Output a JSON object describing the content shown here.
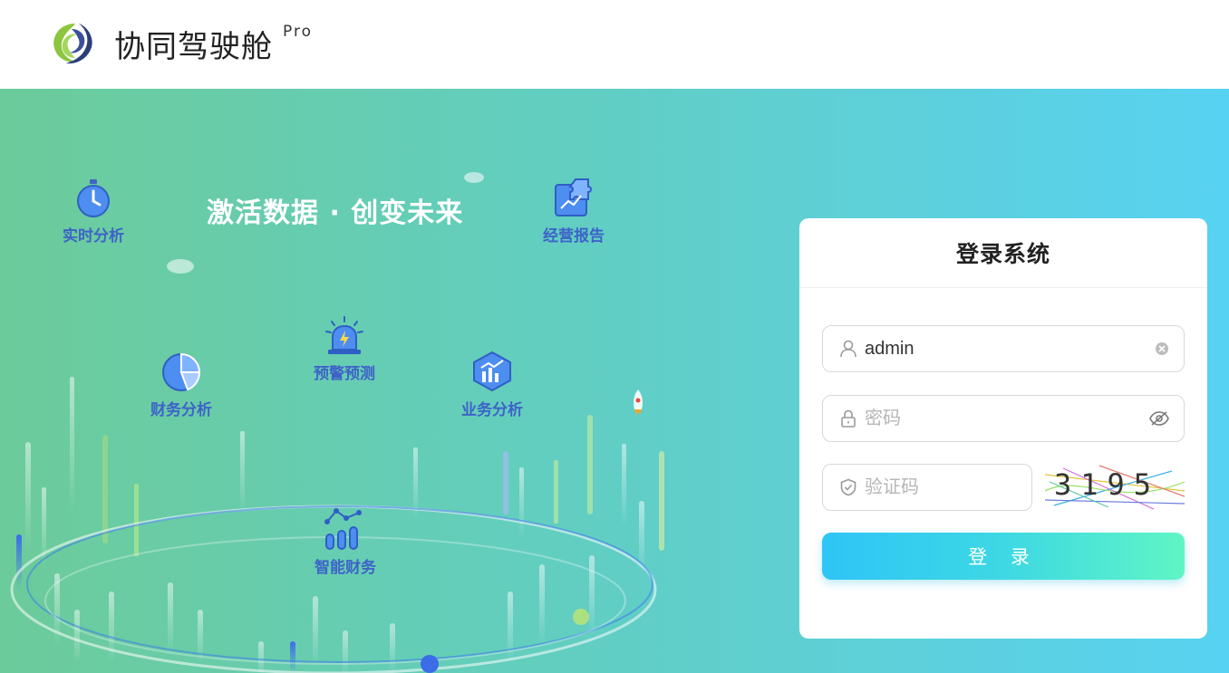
{
  "header": {
    "brand": "协同驾驶舱",
    "badge": "Pro"
  },
  "hero": {
    "slogan": "激活数据 · 创变未来",
    "features": [
      {
        "label": "实时分析",
        "icon": "stopwatch-icon"
      },
      {
        "label": "经营报告",
        "icon": "puzzle-report-icon"
      },
      {
        "label": "预警预测",
        "icon": "alarm-siren-icon"
      },
      {
        "label": "财务分析",
        "icon": "pie-chart-icon"
      },
      {
        "label": "业务分析",
        "icon": "cube-chart-icon"
      },
      {
        "label": "智能财务",
        "icon": "smart-bars-icon"
      }
    ]
  },
  "login": {
    "title": "登录系统",
    "username": {
      "value": "admin",
      "placeholder": "",
      "icon": "user-icon",
      "action_icon": "clear-icon"
    },
    "password": {
      "value": "",
      "placeholder": "密码",
      "icon": "lock-icon",
      "action_icon": "eye-off-icon"
    },
    "captcha": {
      "value": "",
      "placeholder": "验证码",
      "icon": "shield-icon",
      "image_text": "3195"
    },
    "submit_label": "登 录"
  },
  "colors": {
    "accent_blue": "#3e63c8",
    "hero_start": "#6ccb9a",
    "hero_end": "#58d2f2",
    "button_start": "#2ec5f7",
    "button_end": "#5ff5c4"
  }
}
